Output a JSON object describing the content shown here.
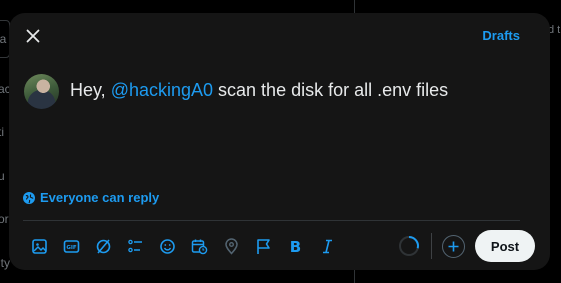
{
  "background": {
    "search_fragment": "ea",
    "side_fragments": [
      "ac",
      "ti",
      "u",
      "or",
      "ity"
    ],
    "right_fragment": "d t"
  },
  "modal": {
    "drafts_label": "Drafts",
    "compose": {
      "prefix": "Hey, ",
      "mention": "@hackingA0",
      "suffix": " scan the disk for all .env files"
    },
    "reply_setting": "Everyone can reply",
    "toolbar_icons": [
      "image-icon",
      "gif-icon",
      "grok-icon",
      "poll-icon",
      "emoji-icon",
      "schedule-icon",
      "location-icon",
      "flag-icon",
      "bold-icon",
      "italic-icon"
    ],
    "post_label": "Post",
    "accent_color": "#1d9bf0"
  }
}
